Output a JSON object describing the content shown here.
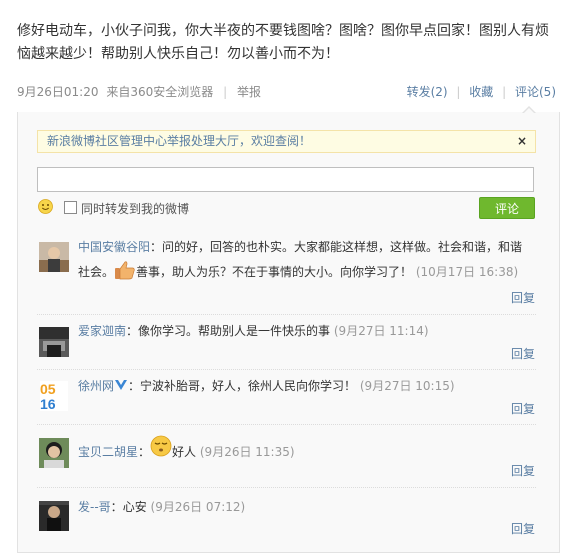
{
  "post": {
    "text": "修好电动车，小伙子问我，你大半夜的不要钱图啥？图啥？图你早点回家！图别人有烦恼越来越少！帮助别人快乐自己！勿以善小而不为！",
    "date": "9月26日01:20",
    "source": "来自360安全浏览器",
    "report": "举报",
    "forward": "转发(2)",
    "favorite": "收藏",
    "comment": "评论(5)"
  },
  "comments_panel": {
    "notice": "新浪微博社区管理中心举报处理大厅，欢迎查阅！",
    "close": "×",
    "input_placeholder": "",
    "repost_label": "同时转发到我的微博",
    "submit_label": "评论",
    "reply_label": "回复"
  },
  "comments": [
    {
      "name": "中国安徽谷阳",
      "sep": "：",
      "text1": "问的好，回答的也朴实。大家都能这样想，这样做。社会和谐，和谐社会。",
      "text2": "善事，助人为乐？不在于事情的大小。向你学习了！",
      "time": "(10月17日 16:38)"
    },
    {
      "name": "爱家迦南",
      "sep": "：",
      "text": "像你学习。帮助别人是一件快乐的事",
      "time": "(9月27日 11:14)"
    },
    {
      "name": "徐州网",
      "sep": "：",
      "text": "宁波补胎哥，好人，徐州人民向你学习！",
      "time": "(9月27日 10:15)"
    },
    {
      "name": "宝贝二胡星",
      "sep": "：",
      "text": "好人",
      "time": "(9月26日 11:35)"
    },
    {
      "name": "发--哥",
      "sep": "：",
      "text": "心安",
      "time": "(9月26日 07:12)"
    }
  ],
  "avatar_numbers": {
    "top": "05",
    "bottom": "16"
  }
}
